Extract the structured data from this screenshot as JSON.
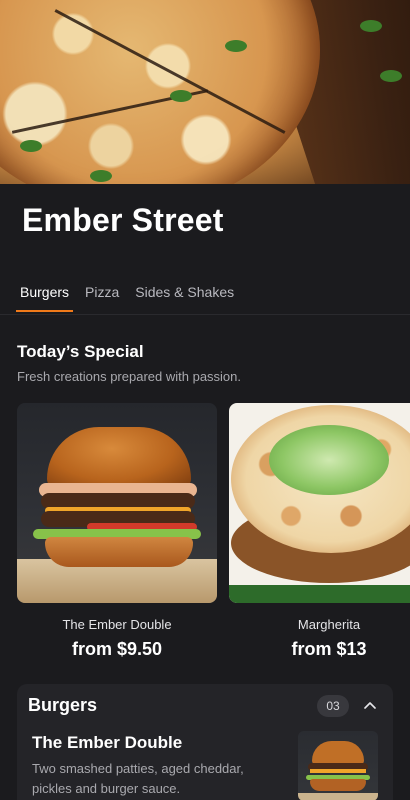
{
  "restaurant": {
    "name": "Ember Street"
  },
  "tabs": [
    {
      "label": "Burgers",
      "active": true
    },
    {
      "label": "Pizza",
      "active": false
    },
    {
      "label": "Sides & Shakes",
      "active": false
    }
  ],
  "special": {
    "title": "Today’s Special",
    "subtitle": "Fresh creations prepared with passion.",
    "cards": [
      {
        "name": "The Ember Double",
        "price": "from $9.50",
        "image": "burger"
      },
      {
        "name": "Margherita",
        "price": "from $13",
        "image": "pizza"
      }
    ]
  },
  "section": {
    "title": "Burgers",
    "count": "03",
    "expanded": true,
    "items": [
      {
        "name": "The Ember Double",
        "description": "Two smashed patties, aged cheddar, pickles and burger sauce."
      }
    ]
  },
  "theme": {
    "background": "#1b1b1e",
    "accent": "#f07a1a",
    "panel": "#242428"
  },
  "icons": {
    "collapse": "chevron-up-icon"
  }
}
